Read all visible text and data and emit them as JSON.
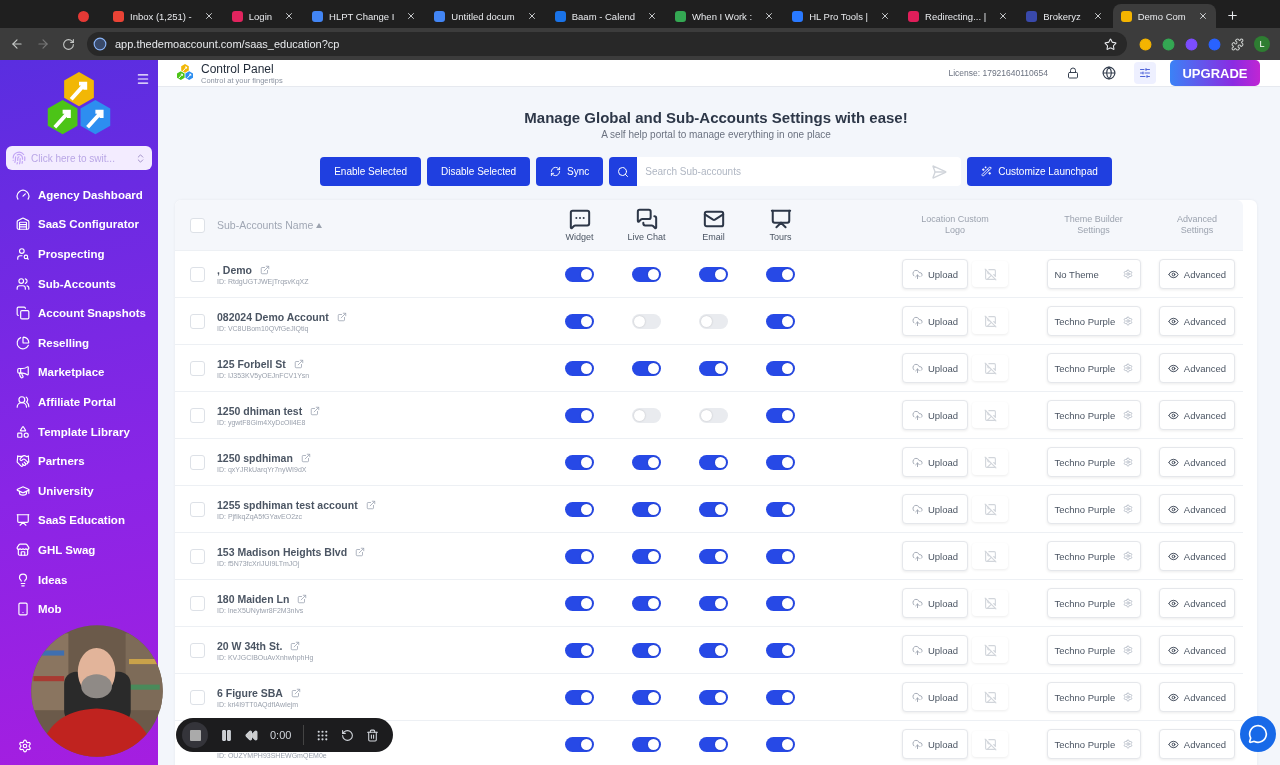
{
  "browser": {
    "tabs": [
      {
        "color": "#e53935",
        "selected": false
      },
      {
        "title": "Inbox (1,251) -",
        "color": "#ea4335",
        "selected": false
      },
      {
        "title": "Login",
        "color": "#e0245e",
        "selected": false
      },
      {
        "title": "HLPT Change I",
        "color": "#4285f4",
        "selected": false
      },
      {
        "title": "Untitled docum",
        "color": "#4285f4",
        "selected": false
      },
      {
        "title": "Baam - Calend",
        "color": "#1a73e8",
        "selected": false
      },
      {
        "title": "When I Work :",
        "color": "#34a853",
        "selected": false
      },
      {
        "title": "HL Pro Tools |",
        "color": "#2979ff",
        "selected": false
      },
      {
        "title": "Redirecting... |",
        "color": "#e01e5a",
        "selected": false
      },
      {
        "title": "Brokeryz",
        "color": "#3949ab",
        "selected": false
      },
      {
        "title": "Demo Com",
        "color": "#f4b400",
        "selected": true
      }
    ],
    "url": "app.thedemoaccount.com/saas_education?cp",
    "profile": "L"
  },
  "sidebar": {
    "switcher_placeholder": "Click here to swit...",
    "items": [
      {
        "label": "Agency Dashboard"
      },
      {
        "label": "SaaS Configurator"
      },
      {
        "label": "Prospecting"
      },
      {
        "label": "Sub-Accounts"
      },
      {
        "label": "Account Snapshots"
      },
      {
        "label": "Reselling"
      },
      {
        "label": "Marketplace"
      },
      {
        "label": "Affiliate Portal"
      },
      {
        "label": "Template Library"
      },
      {
        "label": "Partners"
      },
      {
        "label": "University"
      },
      {
        "label": "SaaS Education"
      },
      {
        "label": "GHL Swag"
      },
      {
        "label": "Ideas"
      },
      {
        "label": "Mob"
      }
    ]
  },
  "header": {
    "title": "Control Panel",
    "subtitle": "Control at your fingertips",
    "license": "License: 17921640110654",
    "upgrade": "UPGRADE"
  },
  "hero": {
    "title": "Manage Global and Sub-Accounts Settings with ease!",
    "subtitle": "A self help portal to manage everything in one place"
  },
  "toolbar": {
    "enable": "Enable Selected",
    "disable": "Disable Selected",
    "sync": "Sync",
    "search_placeholder": "Search Sub-accounts",
    "customize": "Customize Launchpad"
  },
  "table": {
    "select_all_checked": false,
    "columns": {
      "name": "Sub-Accounts Name",
      "widget": "Widget",
      "live_chat": "Live Chat",
      "email": "Email",
      "tours": "Tours",
      "logo": "Location Custom Logo",
      "theme": "Theme Builder Settings",
      "advanced": "Advanced Settings"
    },
    "rows": [
      {
        "checked": false,
        "name": ", Demo",
        "id": "ID: RtdgUGTJWEjTrqsvKqXZ",
        "toggles": [
          {
            "on": true
          },
          {
            "on": true
          },
          {
            "on": true
          },
          {
            "on": true
          }
        ],
        "upload": "Upload",
        "theme": "No Theme",
        "advanced": "Advanced"
      },
      {
        "checked": false,
        "name": "082024 Demo Account",
        "id": "ID: VC8UBom10QVfGeJIQtiq",
        "toggles": [
          {
            "on": true
          },
          {
            "on": false
          },
          {
            "on": false
          },
          {
            "on": true
          }
        ],
        "upload": "Upload",
        "theme": "Techno Purple",
        "advanced": "Advanced"
      },
      {
        "checked": false,
        "name": "125 Forbell St",
        "id": "ID: IJ353KV5yOEJnFCV1Ysn",
        "toggles": [
          {
            "on": true
          },
          {
            "on": true
          },
          {
            "on": true
          },
          {
            "on": true
          }
        ],
        "upload": "Upload",
        "theme": "Techno Purple",
        "advanced": "Advanced"
      },
      {
        "checked": false,
        "name": "1250 dhiman test",
        "id": "ID: ygwtF8Gim4XyDcOIl4E8",
        "toggles": [
          {
            "on": true
          },
          {
            "on": false
          },
          {
            "on": false
          },
          {
            "on": true
          }
        ],
        "upload": "Upload",
        "theme": "Techno Purple",
        "advanced": "Advanced"
      },
      {
        "checked": false,
        "name": "1250 spdhiman",
        "id": "ID: qxYJRkUarqYr7nyWI9dX",
        "toggles": [
          {
            "on": true
          },
          {
            "on": true
          },
          {
            "on": true
          },
          {
            "on": true
          }
        ],
        "upload": "Upload",
        "theme": "Techno Purple",
        "advanced": "Advanced"
      },
      {
        "checked": false,
        "name": "1255 spdhiman test account",
        "id": "ID: PjfIkqZqA5fGYavEO2zc",
        "toggles": [
          {
            "on": true
          },
          {
            "on": true
          },
          {
            "on": true
          },
          {
            "on": true
          }
        ],
        "upload": "Upload",
        "theme": "Techno Purple",
        "advanced": "Advanced"
      },
      {
        "checked": false,
        "name": "153 Madison Heights Blvd",
        "id": "ID: f5N73fcXrIJUI9LTmJOj",
        "toggles": [
          {
            "on": true
          },
          {
            "on": true
          },
          {
            "on": true
          },
          {
            "on": true
          }
        ],
        "upload": "Upload",
        "theme": "Techno Purple",
        "advanced": "Advanced"
      },
      {
        "checked": false,
        "name": "180 Maiden Ln",
        "id": "ID: lneX5UNytwr8F2M3nIvs",
        "toggles": [
          {
            "on": true
          },
          {
            "on": true
          },
          {
            "on": true
          },
          {
            "on": true
          }
        ],
        "upload": "Upload",
        "theme": "Techno Purple",
        "advanced": "Advanced"
      },
      {
        "checked": false,
        "name": "20 W 34th St.",
        "id": "ID: KVJGCIBOuAvXnhwhphHg",
        "toggles": [
          {
            "on": true
          },
          {
            "on": true
          },
          {
            "on": true
          },
          {
            "on": true
          }
        ],
        "upload": "Upload",
        "theme": "Techno Purple",
        "advanced": "Advanced"
      },
      {
        "checked": false,
        "name": "6 Figure SBA",
        "id": "ID: kri4I9TT0AQdfIAwIejm",
        "toggles": [
          {
            "on": true
          },
          {
            "on": true
          },
          {
            "on": true
          },
          {
            "on": true
          }
        ],
        "upload": "Upload",
        "theme": "Techno Purple",
        "advanced": "Advanced"
      },
      {
        "id": "ID: OUZYMPH93SHEWGmQEM0e",
        "toggles": [
          {
            "on": true
          },
          {
            "on": true
          },
          {
            "on": true
          },
          {
            "on": true
          }
        ],
        "upload": "Upload",
        "theme": "Techno Purple",
        "advanced": "Advanced"
      }
    ]
  },
  "recorder": {
    "time": "0:00"
  }
}
